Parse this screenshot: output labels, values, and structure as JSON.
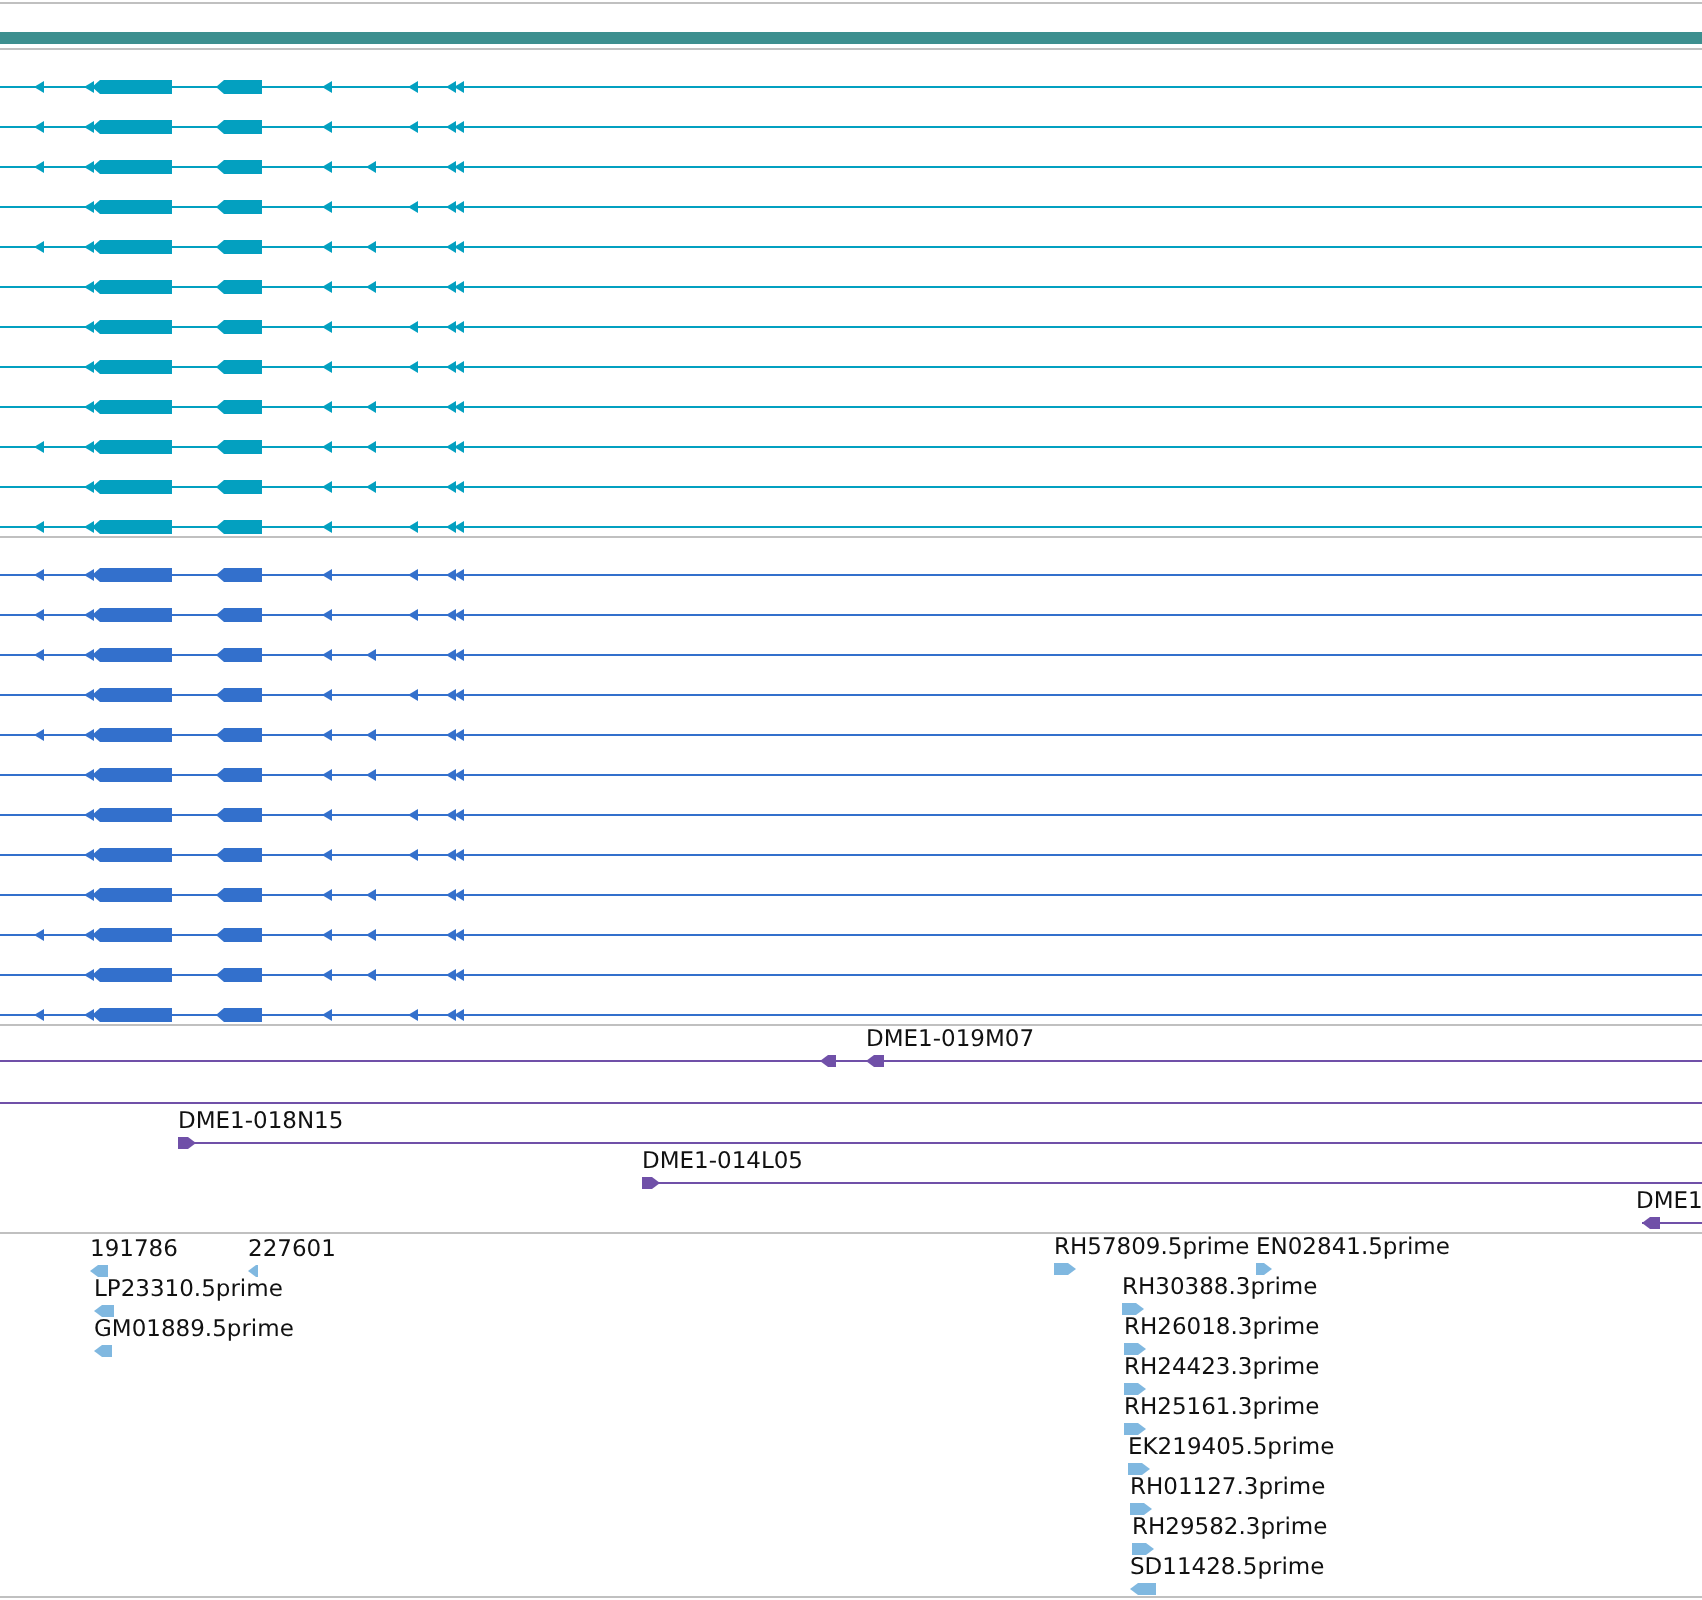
{
  "tracks": [
    {
      "kind": "gene-models",
      "color": "#03a0c0"
    },
    {
      "kind": "gene-models",
      "color": "#3370cc"
    },
    {
      "kind": "clones",
      "color": "#7050a8",
      "features": [
        {
          "label": "DME1-019M07",
          "reverse": true
        },
        {
          "label": "DME1-018N15",
          "reverse": false
        },
        {
          "label": "DME1-014L05",
          "reverse": false
        },
        {
          "label": "DME1",
          "reverse": true
        }
      ]
    },
    {
      "kind": "ests",
      "color": "#80b8e0",
      "features": [
        {
          "label": "191786",
          "reverse": true
        },
        {
          "label": "227601",
          "reverse": true
        },
        {
          "label": "LP23310.5prime",
          "reverse": true
        },
        {
          "label": "GM01889.5prime",
          "reverse": true
        },
        {
          "label": "RH57809.5prime",
          "reverse": false
        },
        {
          "label": "EN02841.5prime",
          "reverse": false
        },
        {
          "label": "RH30388.3prime",
          "reverse": false
        },
        {
          "label": "RH26018.3prime",
          "reverse": false
        },
        {
          "label": "RH24423.3prime",
          "reverse": false
        },
        {
          "label": "RH25161.3prime",
          "reverse": false
        },
        {
          "label": "EK219405.5prime",
          "reverse": false
        },
        {
          "label": "RH01127.3prime",
          "reverse": false
        },
        {
          "label": "RH29582.3prime",
          "reverse": false
        },
        {
          "label": "SD11428.5prime",
          "reverse": true
        }
      ]
    }
  ]
}
